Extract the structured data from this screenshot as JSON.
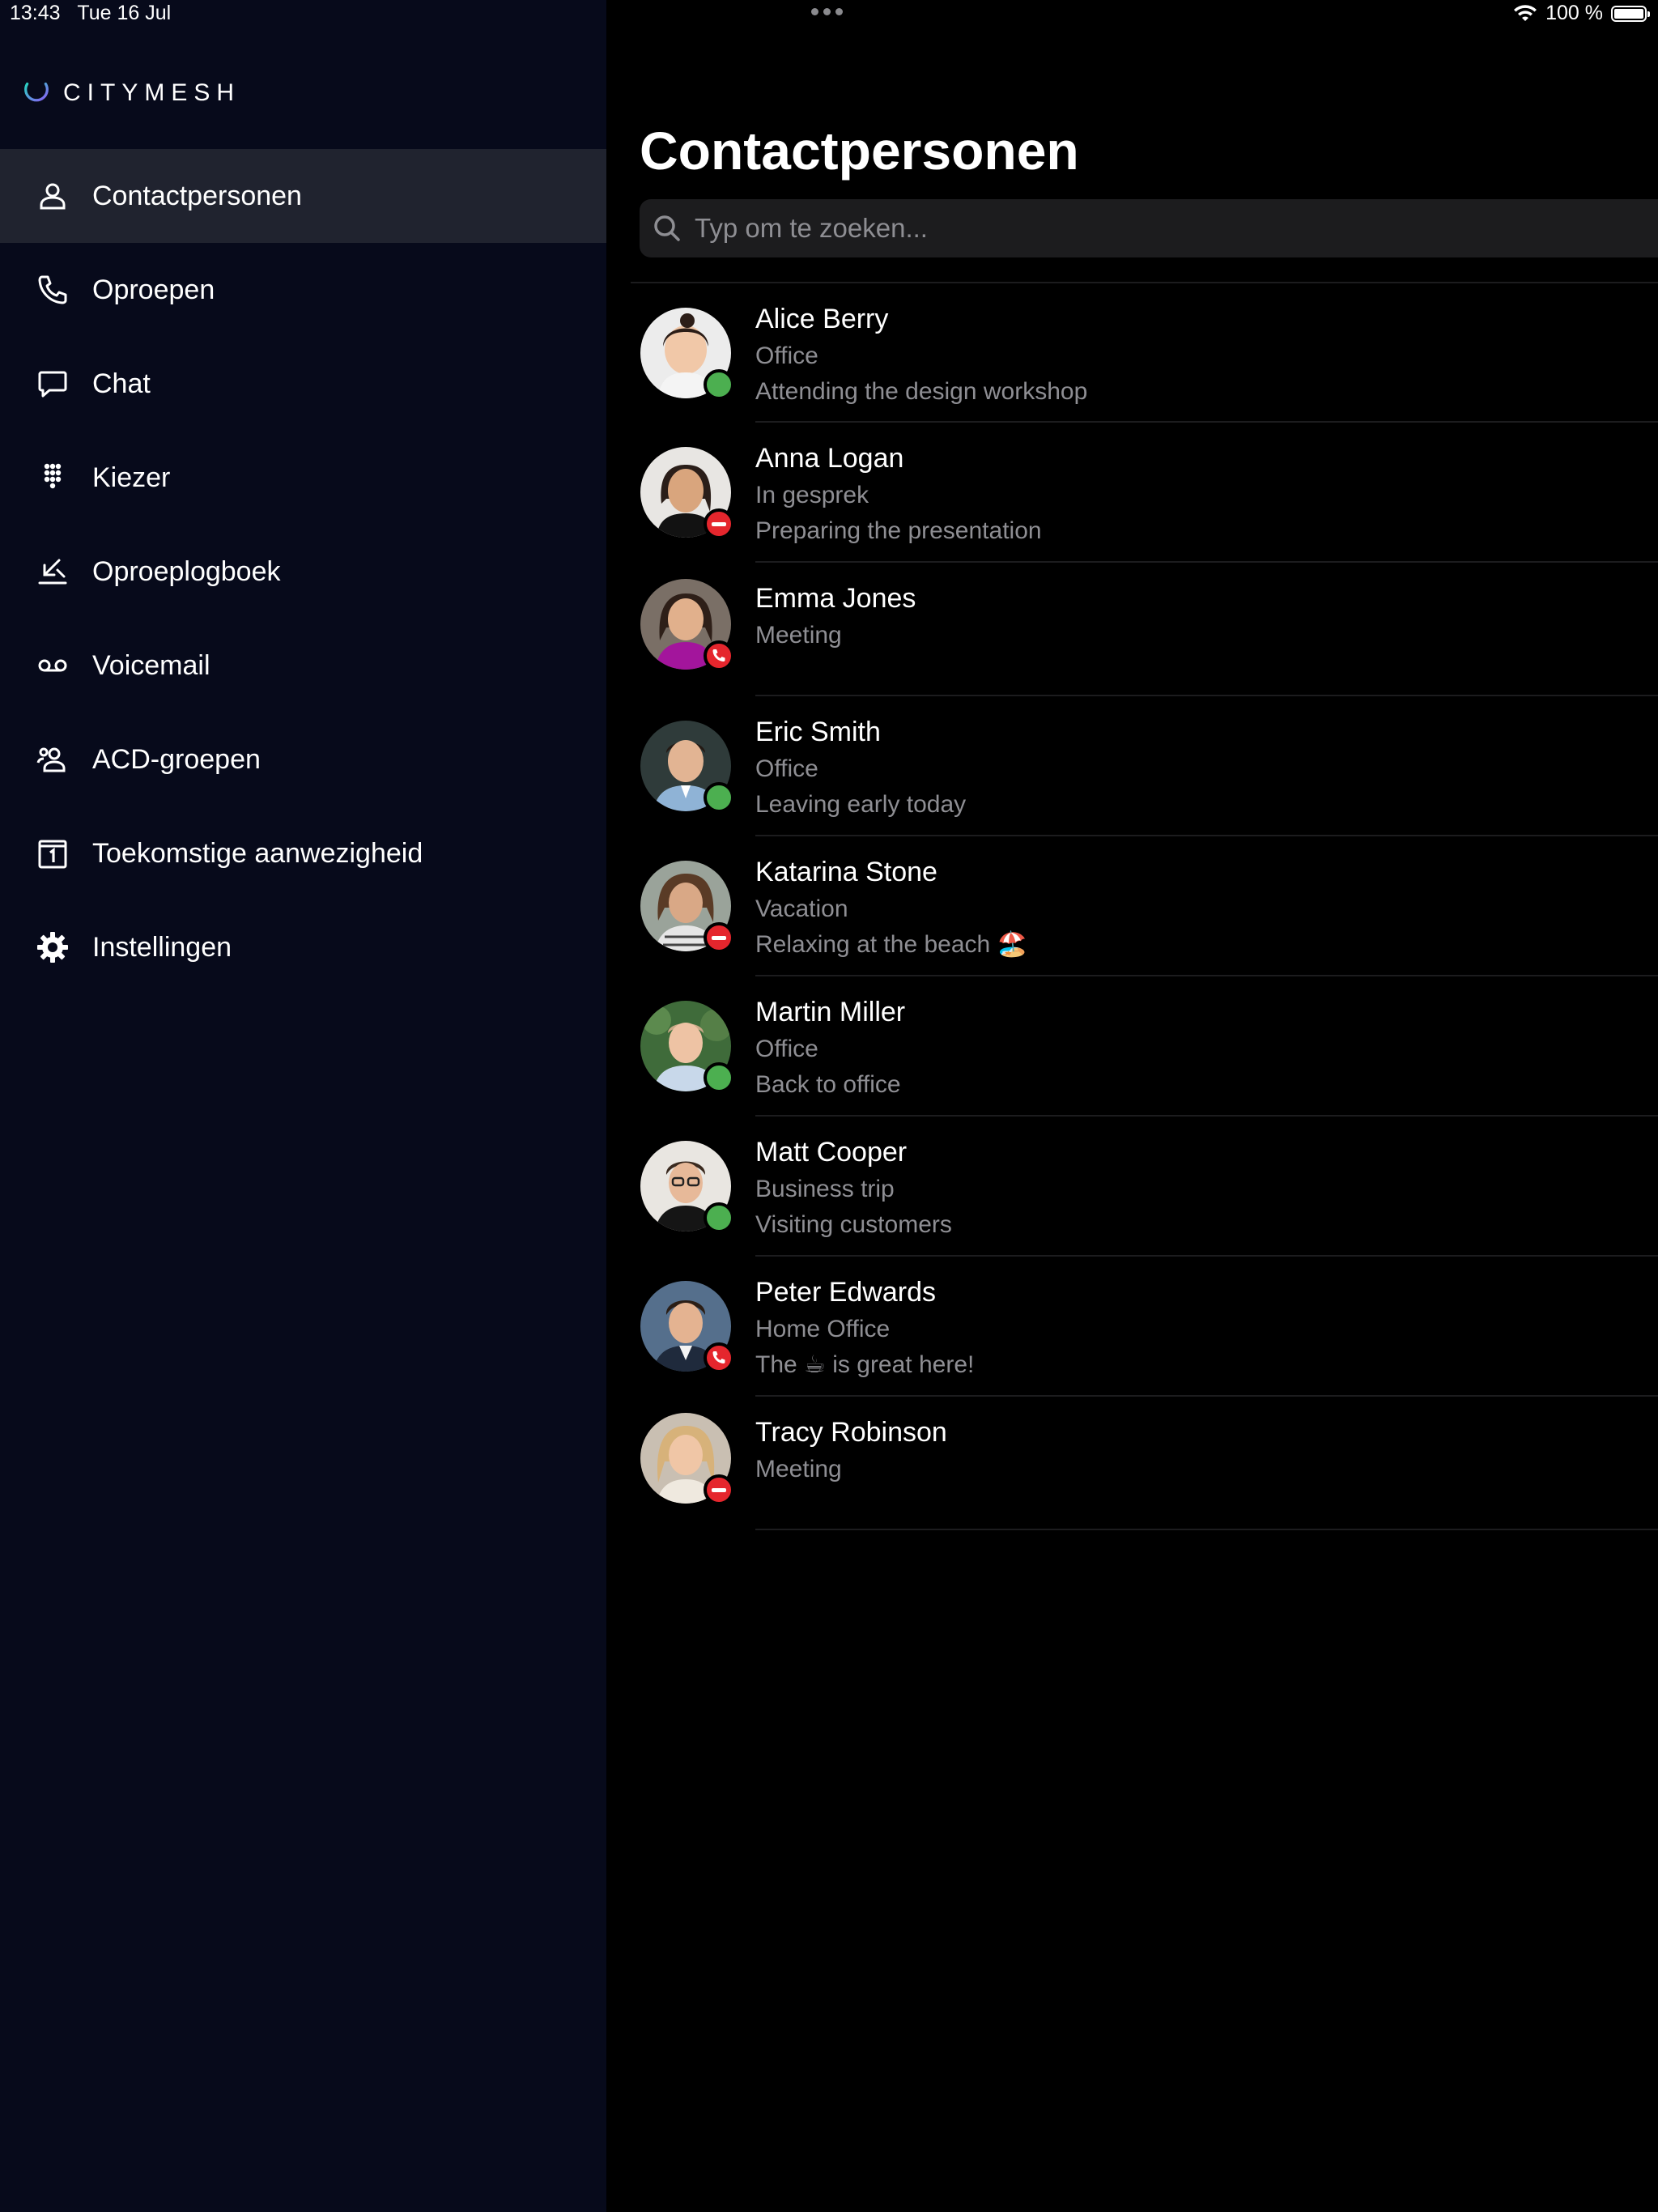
{
  "status_bar": {
    "time": "13:43",
    "date": "Tue 16 Jul",
    "battery": "100 %",
    "battery_level": 1.0
  },
  "brand": {
    "name": "CITYMESH"
  },
  "sidebar": {
    "items": [
      {
        "label": "Contactpersonen",
        "icon": "contacts-icon",
        "active": true
      },
      {
        "label": "Oproepen",
        "icon": "phone-icon"
      },
      {
        "label": "Chat",
        "icon": "chat-bubble-icon"
      },
      {
        "label": "Kiezer",
        "icon": "keypad-icon"
      },
      {
        "label": "Oproeplogboek",
        "icon": "call-log-icon"
      },
      {
        "label": "Voicemail",
        "icon": "voicemail-icon"
      },
      {
        "label": "ACD-groepen",
        "icon": "group-icon"
      },
      {
        "label": "Toekomstige aanwezigheid",
        "icon": "calendar-icon"
      },
      {
        "label": "Instellingen",
        "icon": "gear-icon"
      }
    ]
  },
  "main": {
    "title": "Contactpersonen",
    "search": {
      "placeholder": "Typ om te zoeken...",
      "value": ""
    },
    "contacts": [
      {
        "name": "Alice Berry",
        "status": "Office",
        "note": "Attending the design workshop",
        "presence": "available"
      },
      {
        "name": "Anna Logan",
        "status": "In gesprek",
        "note": "Preparing the presentation",
        "presence": "busy"
      },
      {
        "name": "Emma Jones",
        "status": "Meeting",
        "note": "",
        "presence": "call"
      },
      {
        "name": "Eric Smith",
        "status": "Office",
        "note": "Leaving early today",
        "presence": "available"
      },
      {
        "name": "Katarina Stone",
        "status": "Vacation",
        "note": "Relaxing at the beach 🏖️",
        "presence": "busy"
      },
      {
        "name": "Martin Miller",
        "status": "Office",
        "note": "Back to office",
        "presence": "available"
      },
      {
        "name": "Matt Cooper",
        "status": "Business trip",
        "note": "Visiting customers",
        "presence": "available"
      },
      {
        "name": "Peter Edwards",
        "status": "Home Office",
        "note": "The ☕ is great here!",
        "presence": "call"
      },
      {
        "name": "Tracy Robinson",
        "status": "Meeting",
        "note": "",
        "presence": "busy"
      }
    ]
  },
  "colors": {
    "sidebar_bg": "#070a1b",
    "active_item_bg": "#20232f",
    "available": "#4caf50",
    "busy": "#e5262d",
    "accent": "#2d63e3"
  }
}
